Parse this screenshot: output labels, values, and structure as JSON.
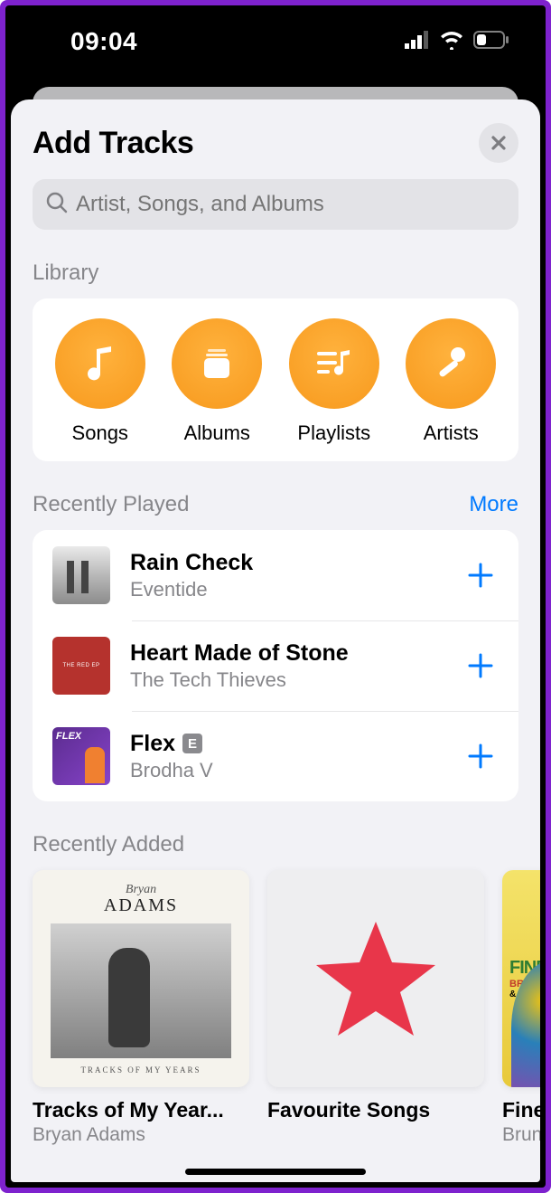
{
  "status": {
    "time": "09:04"
  },
  "sheet": {
    "title": "Add Tracks",
    "search_placeholder": "Artist, Songs, and Albums"
  },
  "library": {
    "label": "Library",
    "items": [
      {
        "label": "Songs"
      },
      {
        "label": "Albums"
      },
      {
        "label": "Playlists"
      },
      {
        "label": "Artists"
      }
    ]
  },
  "recent_played": {
    "label": "Recently Played",
    "more": "More",
    "tracks": [
      {
        "title": "Rain Check",
        "artist": "Eventide",
        "explicit": false
      },
      {
        "title": "Heart Made of Stone",
        "artist": "The Tech Thieves",
        "explicit": false
      },
      {
        "title": "Flex",
        "artist": "Brodha V",
        "explicit": true
      }
    ]
  },
  "recent_added": {
    "label": "Recently Added",
    "albums": [
      {
        "title": "Tracks of My Year...",
        "artist": "Bryan Adams"
      },
      {
        "title": "Favourite Songs",
        "artist": ""
      },
      {
        "title": "Finess",
        "artist": "Bruno"
      }
    ]
  },
  "explicit_badge": "E",
  "adams_cover": {
    "first": "Bryan",
    "last": "ADAMS",
    "sub": "TRACKS OF MY YEARS"
  },
  "finesse_cover": {
    "t1": "FINES",
    "t2": "BRUNO M",
    "t3": "& CARDI B"
  }
}
